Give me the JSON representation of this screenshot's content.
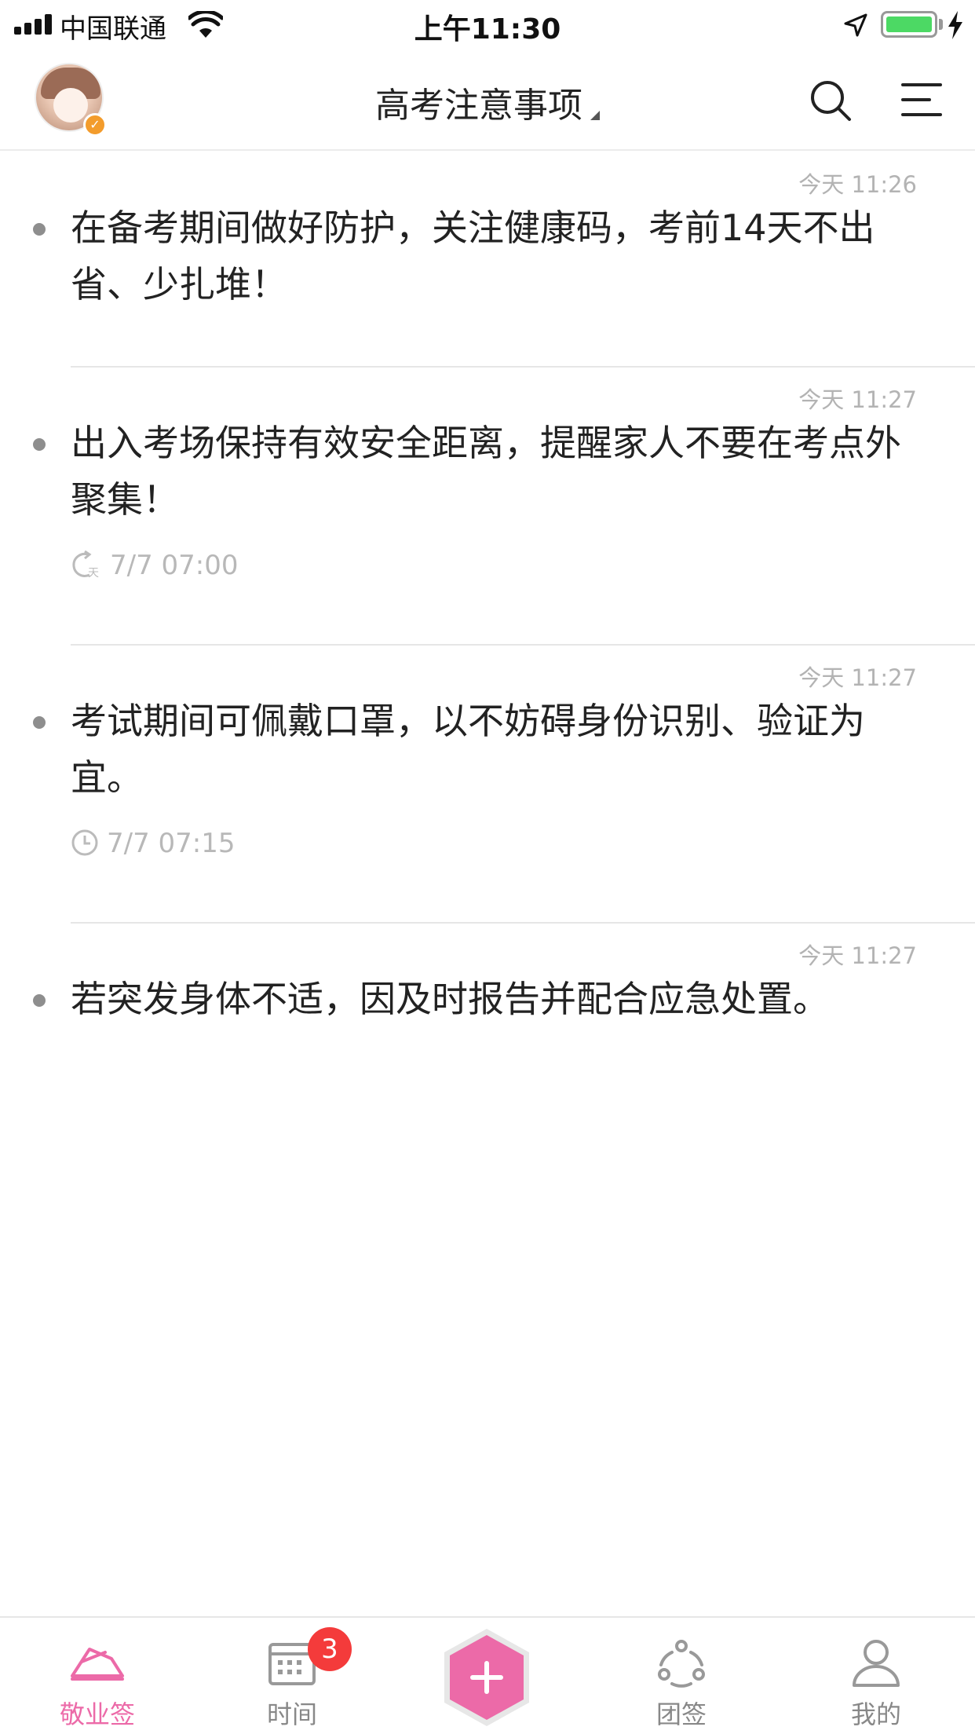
{
  "status_bar": {
    "carrier": "中国联通",
    "time": "上午11:30"
  },
  "header": {
    "title": "高考注意事项"
  },
  "notes": [
    {
      "time": "今天 11:26",
      "text": "在备考期间做好防护，关注健康码，考前14天不出省、少扎堆！",
      "reminder": ""
    },
    {
      "time": "今天 11:27",
      "text": "出入考场保持有效安全距离，提醒家人不要在考点外聚集！",
      "reminder": "7/7 07:00",
      "reminder_type": "repeat-daily-icon"
    },
    {
      "time": "今天 11:27",
      "text": "考试期间可佩戴口罩，以不妨碍身份识别、验证为宜。",
      "reminder": "7/7 07:15",
      "reminder_type": "clock-icon"
    },
    {
      "time": "今天 11:27",
      "text": "若突发身体不适，因及时报告并配合应急处置。",
      "reminder": ""
    }
  ],
  "tabbar": {
    "tabs": [
      {
        "label": "敬业签",
        "icon": "notebook-icon",
        "active": true
      },
      {
        "label": "时间",
        "icon": "calendar-icon",
        "badge": "3"
      },
      {
        "label": "",
        "icon": "add-icon"
      },
      {
        "label": "团签",
        "icon": "team-icon"
      },
      {
        "label": "我的",
        "icon": "profile-icon"
      }
    ]
  },
  "colors": {
    "accent": "#ec6aa8",
    "badge": "#f43b3b",
    "battery": "#4cd964"
  }
}
